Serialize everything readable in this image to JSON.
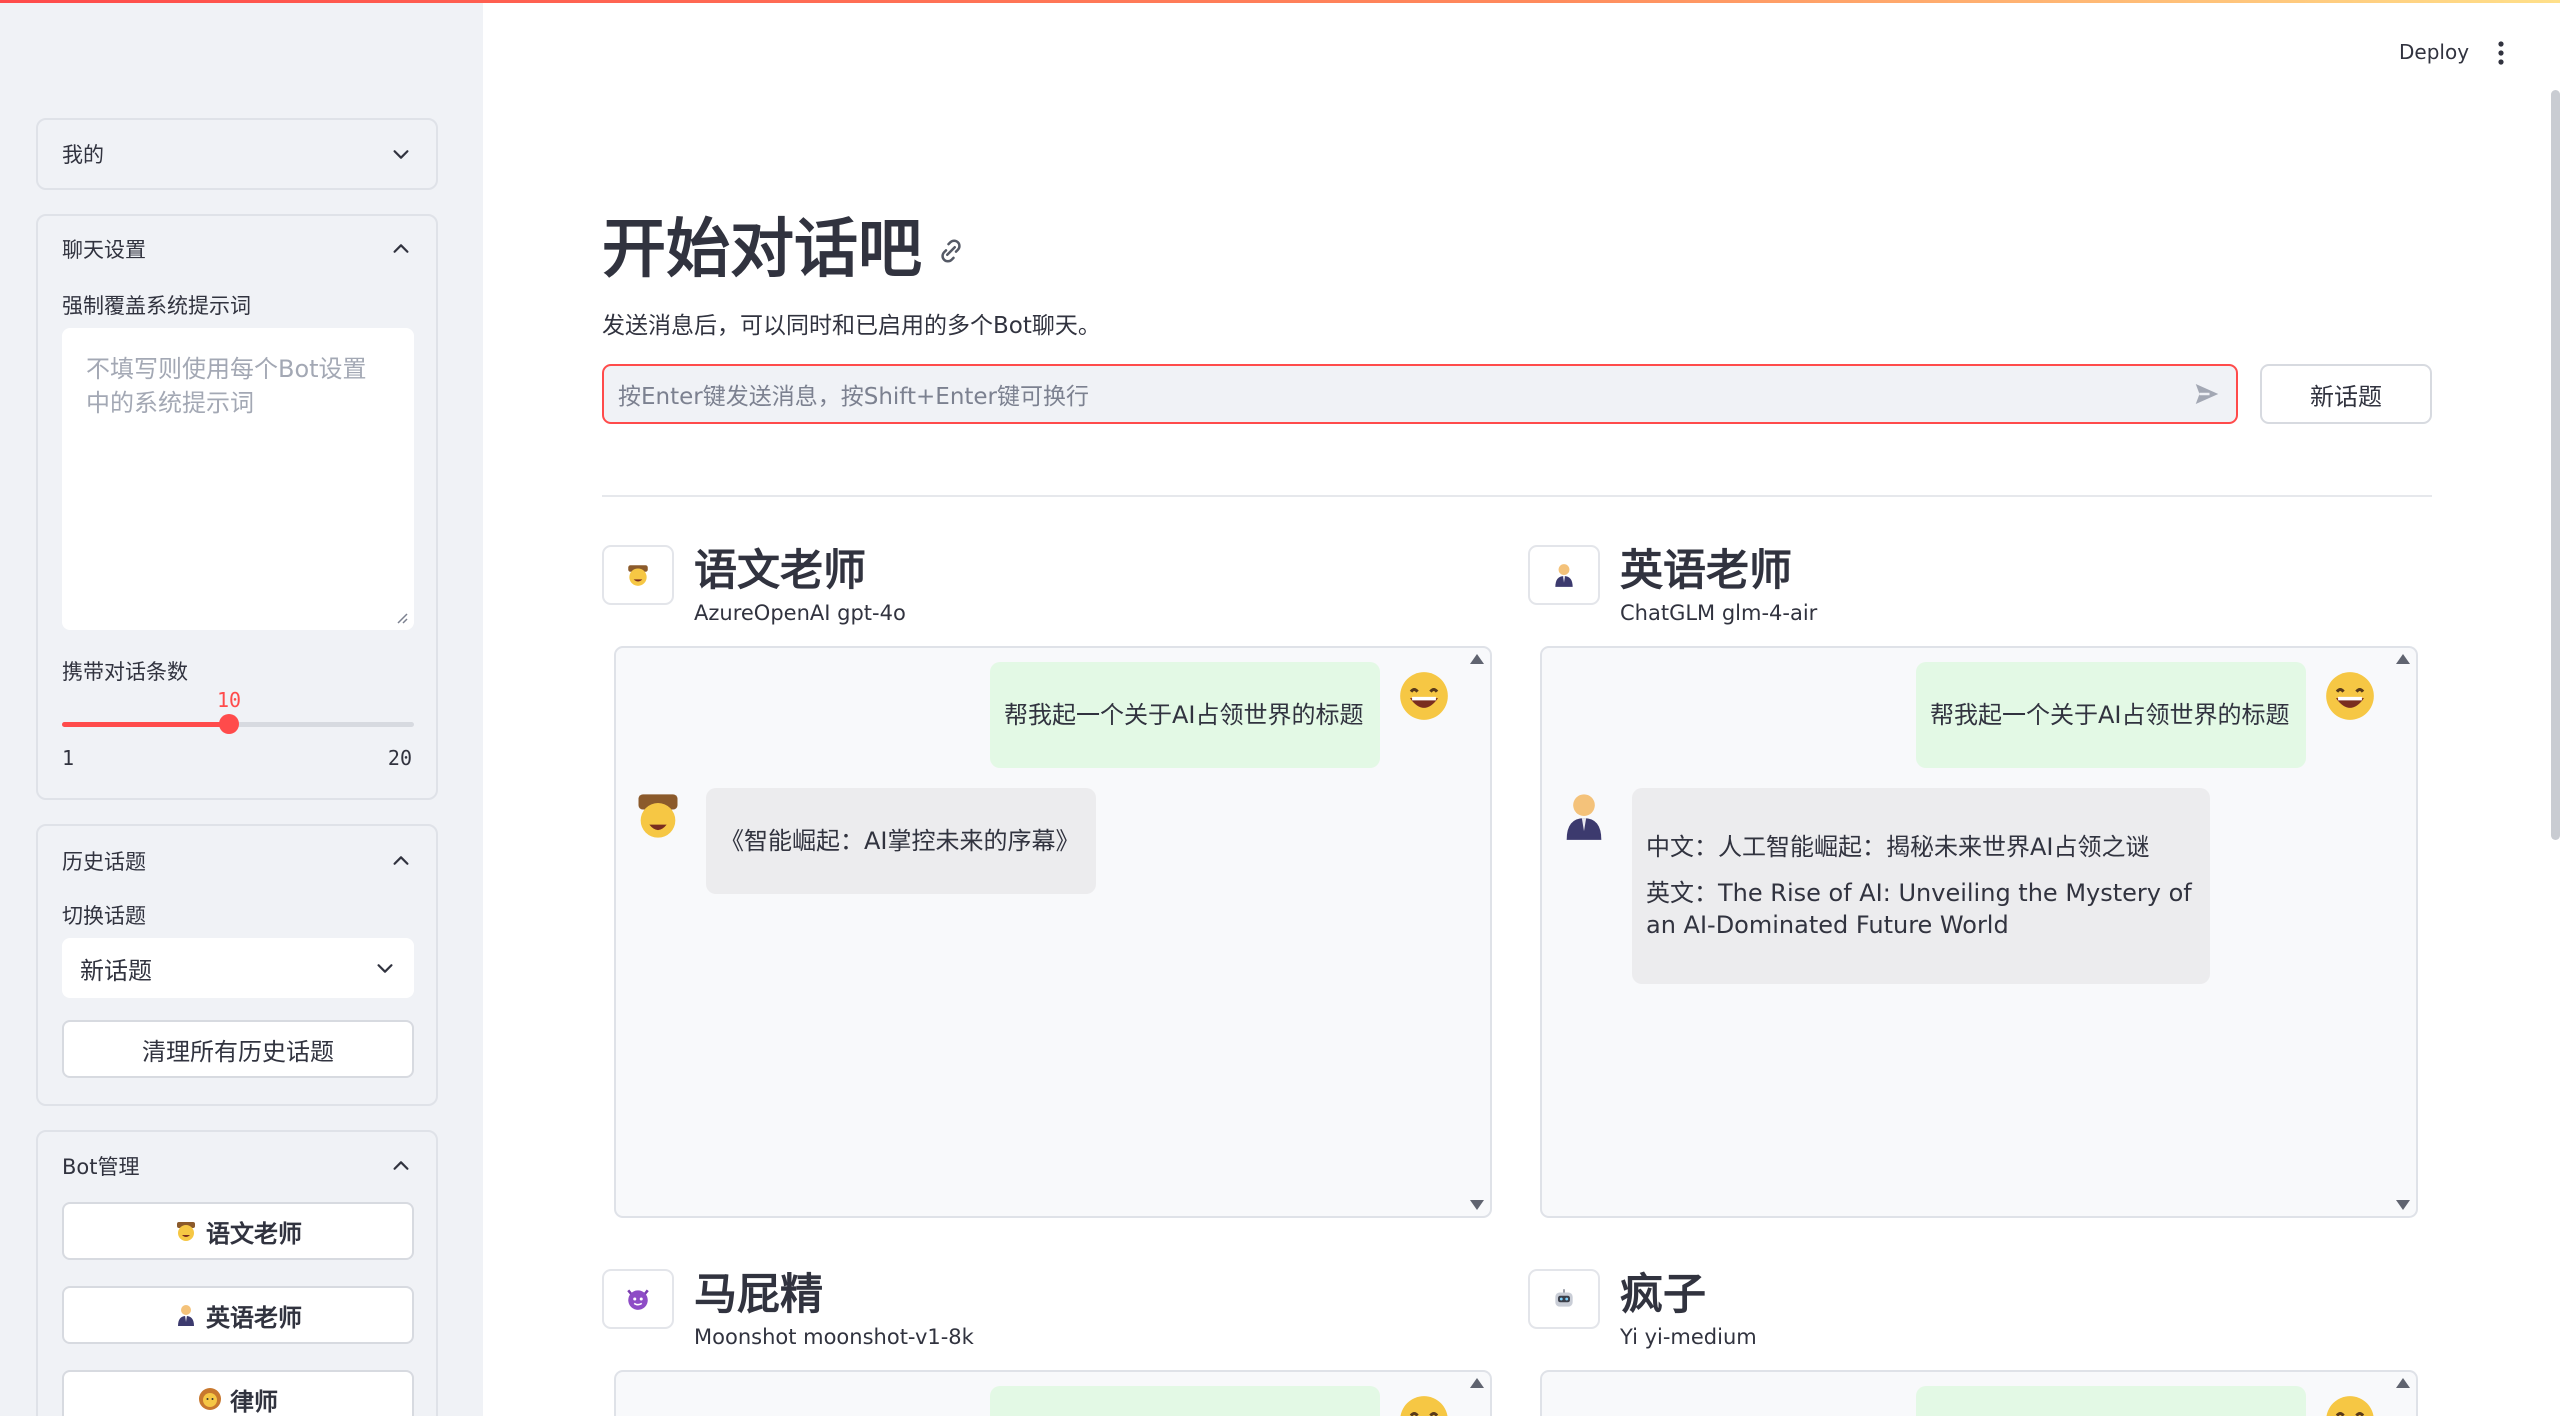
{
  "header": {
    "deploy_label": "Deploy"
  },
  "sidebar": {
    "mine": {
      "label": "我的"
    },
    "chat_settings": {
      "label": "聊天设置",
      "override_label": "强制覆盖系统提示词",
      "override_placeholder": "不填写则使用每个Bot设置中的系统提示词",
      "history_count_label": "携带对话条数",
      "slider_value": "10",
      "slider_min": "1",
      "slider_max": "20",
      "slider_fraction": 0.4737
    },
    "history": {
      "label": "历史话题",
      "switch_label": "切换话题",
      "selected": "新话题",
      "clear_label": "清理所有历史话题"
    },
    "bot_manage": {
      "label": "Bot管理",
      "bots": [
        "语文老师",
        "英语老师",
        "律师"
      ]
    }
  },
  "main": {
    "title": "开始对话吧",
    "subtitle": "发送消息后，可以同时和已启用的多个Bot聊天。",
    "input_placeholder": "按Enter键发送消息，按Shift+Enter键可换行",
    "new_topic_label": "新话题",
    "bots": [
      {
        "name": "语文老师",
        "model": "AzureOpenAI gpt-4o",
        "user_message": "帮我起一个关于AI占领世界的标题",
        "reply": [
          "《智能崛起：AI掌控未来的序幕》"
        ]
      },
      {
        "name": "英语老师",
        "model": "ChatGLM glm-4-air",
        "user_message": "帮我起一个关于AI占领世界的标题",
        "reply": [
          "中文：人工智能崛起：揭秘未来世界AI占领之谜",
          "英文：The Rise of AI: Unveiling the Mystery of an AI-Dominated Future World"
        ]
      },
      {
        "name": "马屁精",
        "model": "Moonshot moonshot-v1-8k"
      },
      {
        "name": "疯子",
        "model": "Yi yi-medium"
      }
    ]
  },
  "colors": {
    "accent": "#ff4b4b",
    "user_bubble": "#e3f9e5",
    "bot_bubble": "#ececee",
    "sidebar_bg": "#f0f2f6"
  },
  "icons": [
    "chevron-down-icon",
    "chevron-up-icon",
    "link-icon",
    "send-icon",
    "kebab-menu-icon",
    "smile-icon",
    "cowboy-icon",
    "businessman-icon",
    "imp-icon",
    "robot-icon",
    "lion-icon"
  ]
}
